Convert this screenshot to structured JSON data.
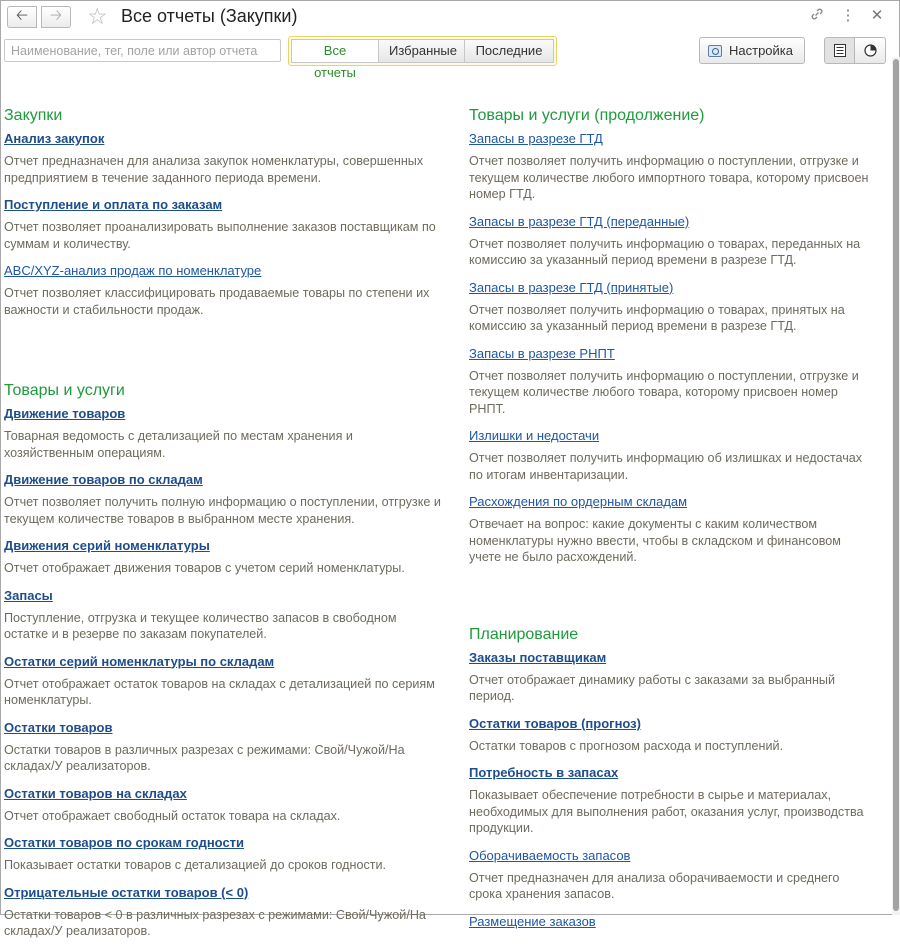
{
  "title": "Все отчеты (Закупки)",
  "search": {
    "placeholder": "Наименование, тег, поле или автор отчета",
    "value": ""
  },
  "tabs": [
    {
      "label": "Все отчеты",
      "active": true
    },
    {
      "label": "Избранные",
      "active": false
    },
    {
      "label": "Последние",
      "active": false
    }
  ],
  "settings_label": "Настройка",
  "icons": {
    "back": "arrow-left",
    "forward": "arrow-right",
    "favorite": "star-outline",
    "link": "chain-link",
    "menu": "vertical-dots",
    "close": "x-mark",
    "settings": "settings-window",
    "list_view": "list-lines",
    "chart_view": "pie-chart"
  },
  "colors": {
    "section": "#1f9a3c",
    "link": "#1f57a5",
    "description": "#6e6b5d",
    "active_tab": "#2b8a2b",
    "tabs_frame": "#e6d36d"
  },
  "left_sections": [
    {
      "title": "Закупки",
      "items": [
        {
          "name": "Анализ закупок",
          "bold": true,
          "desc": "Отчет предназначен для анализа закупок номенклатуры, совершенных предприятием в течение заданного периода времени."
        },
        {
          "name": "Поступление и оплата по заказам",
          "bold": true,
          "desc": "Отчет позволяет проанализировать выполнение заказов поставщикам по суммам и количеству."
        },
        {
          "name": "ABC/XYZ-анализ продаж по номенклатуре",
          "bold": false,
          "desc": "Отчет позволяет классифицировать продаваемые товары по степени их важности и стабильности продаж."
        }
      ]
    },
    {
      "title": "Товары и услуги",
      "items": [
        {
          "name": "Движение товаров",
          "bold": true,
          "desc": "Товарная ведомость с детализацией по местам хранения и хозяйственным операциям."
        },
        {
          "name": "Движение товаров по складам",
          "bold": true,
          "desc": "Отчет позволяет получить полную информацию о поступлении, отгрузке и текущем количестве товаров в выбранном месте хранения."
        },
        {
          "name": "Движения серий номенклатуры",
          "bold": true,
          "desc": "Отчет отображает движения товаров с учетом серий номенклатуры."
        },
        {
          "name": "Запасы",
          "bold": true,
          "desc": "Поступление, отгрузка и текущее количество запасов в свободном остатке и в резерве по заказам покупателей."
        },
        {
          "name": "Остатки серий номенклатуры по складам",
          "bold": true,
          "desc": "Отчет отображает остаток товаров на складах с детализацией по сериям номенклатуры."
        },
        {
          "name": "Остатки товаров",
          "bold": true,
          "desc": "Остатки товаров в различных разрезах с режимами: Свой/Чужой/На складах/У реализаторов."
        },
        {
          "name": "Остатки товаров на складах",
          "bold": true,
          "desc": "Отчет отображает свободный остаток товара на складах."
        },
        {
          "name": "Остатки товаров по срокам годности",
          "bold": true,
          "desc": "Показывает остатки товаров с детализацией до сроков годности."
        },
        {
          "name": "Отрицательные остатки товаров (< 0)",
          "bold": true,
          "desc": "Остатки товаров < 0 в различных разрезах с режимами: Свой/Чужой/На складах/У реализаторов."
        }
      ]
    }
  ],
  "right_sections": [
    {
      "title": "Товары и услуги (продолжение)",
      "items": [
        {
          "name": "Запасы в разрезе ГТД",
          "bold": false,
          "desc": "Отчет позволяет получить информацию о поступлении, отгрузке и текущем количестве любого импортного товара, которому присвоен номер ГТД."
        },
        {
          "name": "Запасы в разрезе ГТД (переданные)",
          "bold": false,
          "desc": "Отчет позволяет получить информацию о товарах, переданных на комиссию за указанный период времени в разрезе ГТД."
        },
        {
          "name": "Запасы в разрезе ГТД (принятые)",
          "bold": false,
          "desc": "Отчет позволяет получить информацию о товарах, принятых на комиссию за указанный период времени в разрезе ГТД."
        },
        {
          "name": "Запасы в разрезе РНПТ",
          "bold": false,
          "desc": "Отчет позволяет получить информацию о поступлении, отгрузке и текущем количестве любого товара, которому присвоен номер РНПТ."
        },
        {
          "name": "Излишки и недостачи",
          "bold": false,
          "desc": "Отчет позволяет получить информацию об излишках и недостачах по итогам инвентаризации."
        },
        {
          "name": "Расхождения по ордерным складам",
          "bold": false,
          "desc": "Отвечает на вопрос: какие документы с каким количеством номенклатуры нужно ввести, чтобы в складском и финансовом учете не было расхождений."
        }
      ]
    },
    {
      "title": "Планирование",
      "items": [
        {
          "name": "Заказы поставщикам",
          "bold": true,
          "desc": "Отчет отображает динамику работы с заказами за выбранный период."
        },
        {
          "name": "Остатки товаров (прогноз)",
          "bold": true,
          "desc": "Остатки товаров с прогнозом расхода и поступлений."
        },
        {
          "name": "Потребность в запасах",
          "bold": true,
          "desc": "Показывает обеспечение потребности в сырье и материалах, необходимых для выполнения работ, оказания услуг, производства продукции."
        },
        {
          "name": "Оборачиваемость запасов",
          "bold": false,
          "desc": "Отчет предназначен для анализа оборачиваемости и среднего срока хранения запасов."
        },
        {
          "name": "Размещение заказов",
          "bold": false,
          "desc": ""
        }
      ]
    }
  ]
}
